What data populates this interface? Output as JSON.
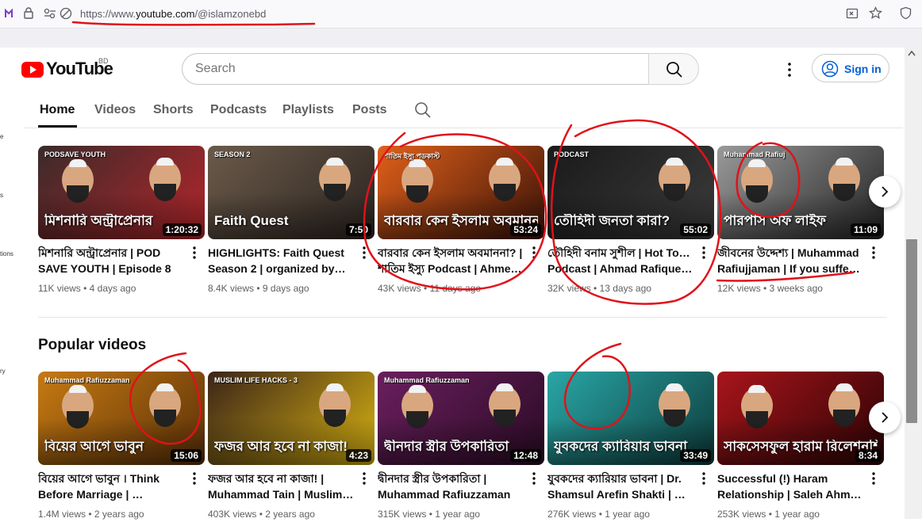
{
  "browser": {
    "url_prefix": "https://www.",
    "url_host": "youtube.com",
    "url_path": "/@islamzonebd"
  },
  "sidebar_fragments": [
    "e",
    "s",
    "tions",
    "ry"
  ],
  "header": {
    "logo_text": "YouTube",
    "region": "BD",
    "search_placeholder": "Search",
    "sign_in_label": "Sign in"
  },
  "tabs": [
    {
      "label": "Home",
      "active": true
    },
    {
      "label": "Videos",
      "active": false
    },
    {
      "label": "Shorts",
      "active": false
    },
    {
      "label": "Podcasts",
      "active": false
    },
    {
      "label": "Playlists",
      "active": false
    },
    {
      "label": "Posts",
      "active": false
    }
  ],
  "row1": [
    {
      "thumb_text": "মিশনারি অন্ট্রাপ্রেনার",
      "thumb_sub": "PODSAVE YOUTH",
      "duration": "1:20:32",
      "title_line1": "মিশনারি অন্ট্রাপ্রেনার | POD",
      "title_line2": "SAVE YOUTH | Episode 8",
      "meta": "11K views • 4 days ago",
      "bg1": "#3a2a2a",
      "bg2": "#b5262b"
    },
    {
      "thumb_text": "Faith Quest",
      "thumb_sub": "SEASON 2",
      "duration": "7:50",
      "title_line1": "HIGHLIGHTS: Faith Quest",
      "title_line2": "Season 2 | organized by…",
      "meta": "8.4K views • 9 days ago",
      "bg1": "#6b5a4a",
      "bg2": "#2b2420"
    },
    {
      "thumb_text": "বারবার কেন ইসলাম অবমাননা?",
      "thumb_sub": "শাতিম ইস্যু পডকাস্ট",
      "duration": "53:24",
      "title_line1": "বারবার কেন ইসলাম অবমাননা? |",
      "title_line2": "শাতিম ইস্যু Podcast | Ahmed…",
      "meta": "43K views • 11 days ago",
      "bg1": "#e0601a",
      "bg2": "#3a1208"
    },
    {
      "thumb_text": "তৌহিদী জনতা কারা?",
      "thumb_sub": "PODCAST",
      "duration": "55:02",
      "title_line1": "তৌহিদী বনাম সুশীল | Hot Topic",
      "title_line2": "Podcast | Ahmad Rafique | …",
      "meta": "32K views • 13 days ago",
      "bg1": "#1a1a1a",
      "bg2": "#3b3b3b"
    },
    {
      "thumb_text": "পারপাস অফ লাইফ",
      "thumb_sub": "Muhammad Rafiuj",
      "duration": "11:09",
      "title_line1": "জীবনের উদ্দেশ্য | Muhammad",
      "title_line2": "Rafiujjaman | If you suffer…",
      "meta": "12K views • 3 weeks ago",
      "bg1": "#9a9a9a",
      "bg2": "#222"
    }
  ],
  "popular_heading": "Popular videos",
  "row2": [
    {
      "thumb_text": "বিয়ের আগে ভাবুন",
      "thumb_sub": "Muhammad Rafiuzzaman",
      "duration": "15:06",
      "title_line1": "বিয়ের আগে ভাবুন । Think",
      "title_line2": "Before Marriage | …",
      "meta": "1.4M views • 2 years ago",
      "bg1": "#c67a12",
      "bg2": "#5a3008"
    },
    {
      "thumb_text": "ফজর আর হবে না কাজা!",
      "thumb_sub": "MUSLIM LIFE HACKS - 3",
      "duration": "4:23",
      "title_line1": "ফজর আর হবে না কাজা! |",
      "title_line2": "Muhammad Tain | Muslim…",
      "meta": "403K views • 2 years ago",
      "bg1": "#3a2418",
      "bg2": "#d8b212"
    },
    {
      "thumb_text": "দ্বীনদার স্ত্রীর উপকারিতা",
      "thumb_sub": "Muhammad Rafiuzzaman",
      "duration": "12:48",
      "title_line1": "দ্বীনদার স্ত্রীর উপকারিতা |",
      "title_line2": "Muhammad Rafiuzzaman",
      "meta": "315K views • 1 year ago",
      "bg1": "#6a1f5e",
      "bg2": "#2a0b24"
    },
    {
      "thumb_text": "যুবকদের ক্যারিয়ার ভাবনা",
      "thumb_sub": "",
      "duration": "33:49",
      "title_line1": "যুবকদের ক্যারিয়ার ভাবনা | Dr.",
      "title_line2": "Shamsul Arefin Shakti | …",
      "meta": "276K views • 1 year ago",
      "bg1": "#2aa6a6",
      "bg2": "#0d3b3b"
    },
    {
      "thumb_text": "সাকসেসফুল হারাম রিলেশনশিপ",
      "thumb_sub": "",
      "duration": "8:34",
      "title_line1": "Successful (!) Haram",
      "title_line2": "Relationship | Saleh Ahmed…",
      "meta": "253K views • 1 year ago",
      "bg1": "#a8151b",
      "bg2": "#2a0304"
    }
  ]
}
